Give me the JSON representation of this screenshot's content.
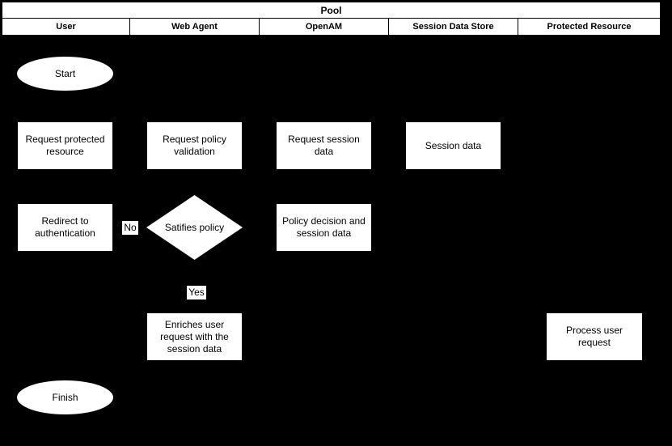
{
  "pool": {
    "title": "Pool",
    "lanes": [
      {
        "label": "User"
      },
      {
        "label": "Web Agent"
      },
      {
        "label": "OpenAM"
      },
      {
        "label": "Session Data Store"
      },
      {
        "label": "Protected Resource"
      }
    ]
  },
  "diagram": {
    "background_color": "#000000",
    "shape_fill_color": "#ffffff",
    "text_color": "#000000",
    "nodes": [
      {
        "id": "start",
        "type": "terminator",
        "lane": "User",
        "label": "Start"
      },
      {
        "id": "request_resource",
        "type": "process",
        "lane": "User",
        "label": "Request protected resource"
      },
      {
        "id": "request_policy",
        "type": "process",
        "lane": "Web Agent",
        "label": "Request policy validation"
      },
      {
        "id": "request_session",
        "type": "process",
        "lane": "OpenAM",
        "label": "Request session data"
      },
      {
        "id": "session_data",
        "type": "process",
        "lane": "Session Data Store",
        "label": "Session data"
      },
      {
        "id": "redirect_auth",
        "type": "process",
        "lane": "User",
        "label": "Redirect to authentication"
      },
      {
        "id": "satifies_policy",
        "type": "decision",
        "lane": "Web Agent",
        "label": "Satifies policy"
      },
      {
        "id": "policy_decision",
        "type": "process",
        "lane": "OpenAM",
        "label": "Policy decision and session data"
      },
      {
        "id": "enriches_request",
        "type": "process",
        "lane": "Web Agent",
        "label": "Enriches user request with the session data"
      },
      {
        "id": "process_request",
        "type": "process",
        "lane": "Protected Resource",
        "label": "Process user request"
      },
      {
        "id": "finish",
        "type": "terminator",
        "lane": "User",
        "label": "Finish"
      }
    ],
    "edge_labels": [
      {
        "id": "no",
        "label": "No",
        "from": "satifies_policy",
        "to": "redirect_auth"
      },
      {
        "id": "yes",
        "label": "Yes",
        "from": "satifies_policy",
        "to": "enriches_request"
      }
    ]
  }
}
